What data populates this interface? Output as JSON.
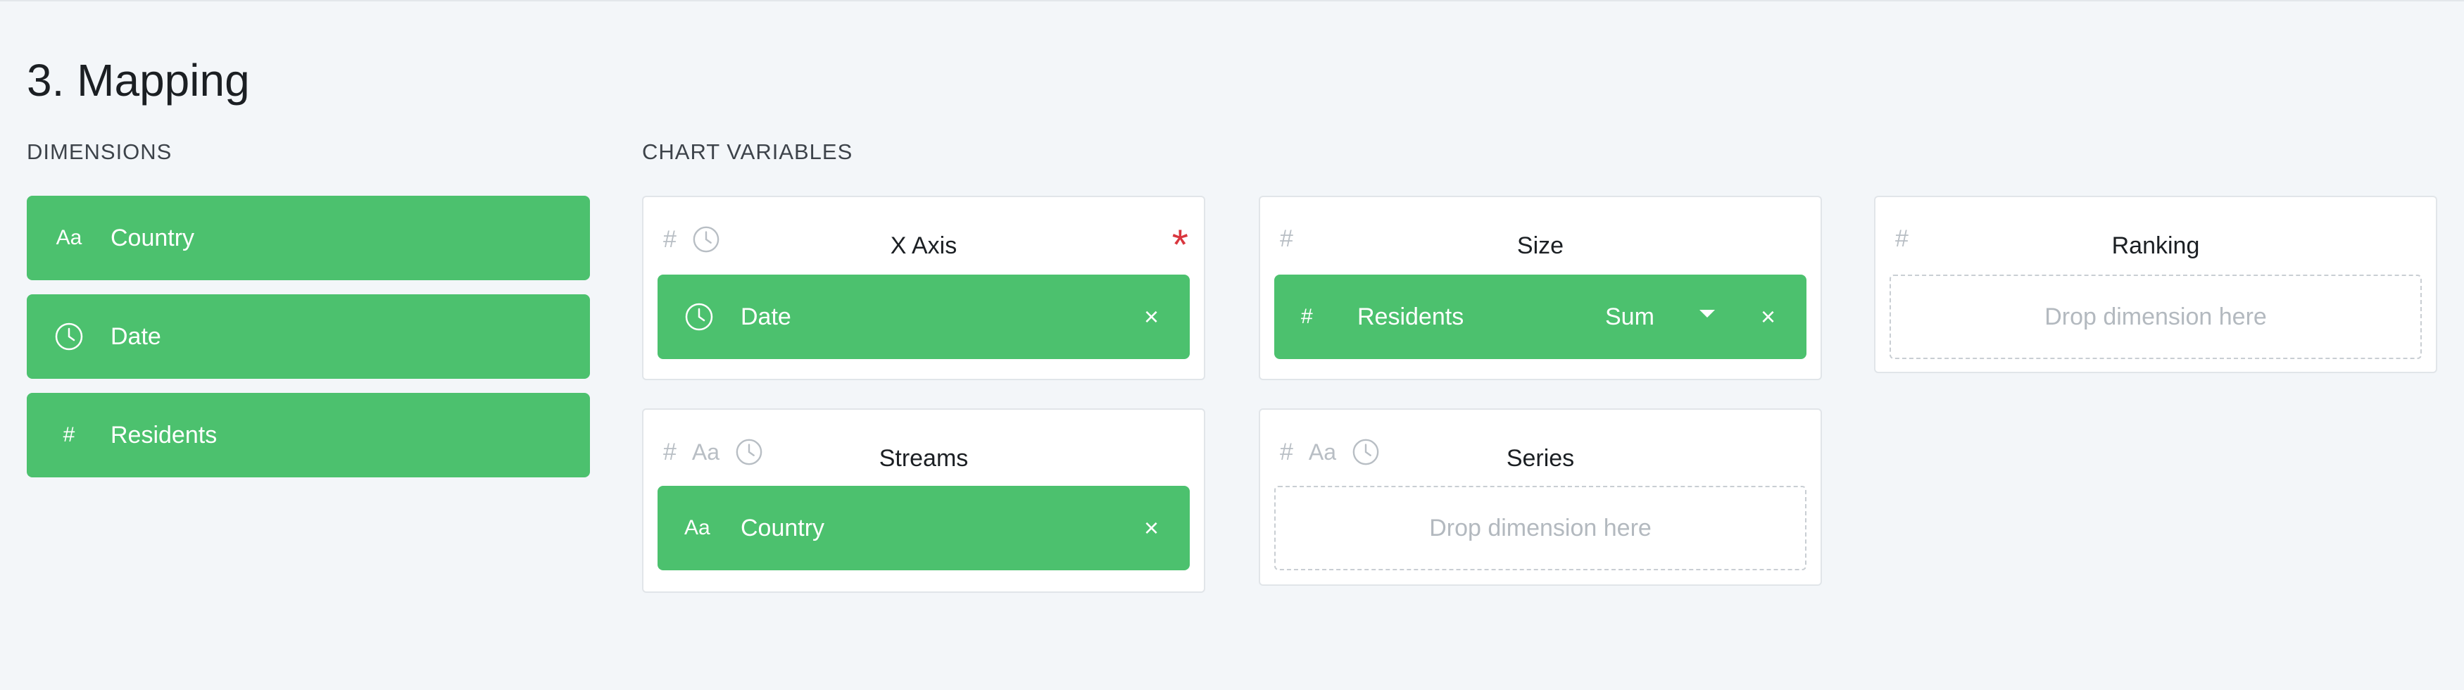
{
  "page_title": "3. Mapping",
  "dimensions": {
    "title": "DIMENSIONS",
    "items": [
      {
        "icon": "text-type-icon",
        "glyph": "Aa",
        "label": "Country"
      },
      {
        "icon": "clock-icon",
        "label": "Date"
      },
      {
        "icon": "hash-icon",
        "glyph": "#",
        "label": "Residents"
      }
    ]
  },
  "chart_variables": {
    "title": "CHART VARIABLES",
    "x_axis": {
      "title": "X Axis",
      "required": "*",
      "type_glyphs": [
        "#"
      ],
      "chip": {
        "label": "Date",
        "close": "×"
      }
    },
    "size": {
      "title": "Size",
      "type_glyphs": [
        "#"
      ],
      "chip": {
        "glyph": "#",
        "label": "Residents",
        "aggregation": "Sum",
        "close": "×"
      }
    },
    "ranking": {
      "title": "Ranking",
      "type_glyphs": [
        "#"
      ],
      "drop_text": "Drop dimension here"
    },
    "streams": {
      "title": "Streams",
      "type_glyphs": [
        "#",
        "Aa"
      ],
      "chip": {
        "glyph": "Aa",
        "label": "Country",
        "close": "×"
      }
    },
    "series": {
      "title": "Series",
      "type_glyphs": [
        "#",
        "Aa"
      ],
      "drop_text": "Drop dimension here"
    }
  },
  "colors": {
    "chip_green": "#4cc16e",
    "required_red": "#d9363e",
    "background": "#f3f6f9"
  }
}
